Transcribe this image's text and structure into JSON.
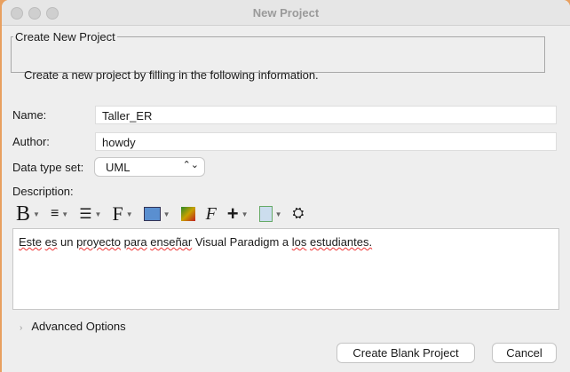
{
  "window": {
    "title": "New Project"
  },
  "group": {
    "legend": "Create New Project",
    "description": "Create a new project by filling in the following information."
  },
  "form": {
    "name_label": "Name:",
    "name_value": "Taller_ER",
    "author_label": "Author:",
    "author_value": "howdy",
    "datatype_label": "Data type set:",
    "datatype_value": "UML",
    "description_label": "Description:"
  },
  "toolbar": {
    "bold": "B",
    "font": "F",
    "add": "+"
  },
  "editor": {
    "words": [
      "Este",
      "es",
      "un",
      "proyecto",
      "para",
      "enseñar",
      "Visual Paradigm a",
      "los",
      "estudiantes."
    ]
  },
  "advanced": {
    "label": "Advanced Options"
  },
  "buttons": {
    "create": "Create Blank Project",
    "cancel": "Cancel"
  }
}
